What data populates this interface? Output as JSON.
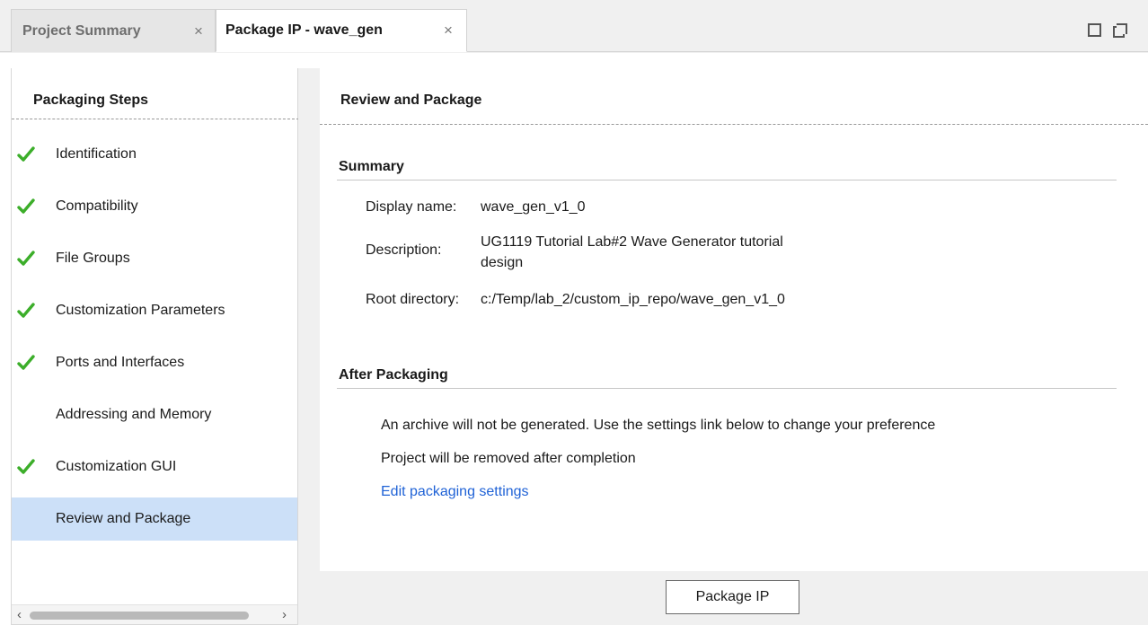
{
  "tabs": [
    {
      "label": "Project Summary",
      "close": "×"
    },
    {
      "label": "Package IP - wave_gen",
      "close": "×"
    }
  ],
  "colors": {
    "check": "#3cae2a",
    "selected_bg": "#cce0f8",
    "link": "#1f62d6"
  },
  "left": {
    "title": "Packaging Steps",
    "steps": [
      {
        "label": "Identification",
        "done": true,
        "icon": "check-icon"
      },
      {
        "label": "Compatibility",
        "done": true,
        "icon": "check-icon"
      },
      {
        "label": "File Groups",
        "done": true,
        "icon": "check-icon"
      },
      {
        "label": "Customization Parameters",
        "done": true,
        "icon": "check-icon"
      },
      {
        "label": "Ports and Interfaces",
        "done": true,
        "icon": "check-icon"
      },
      {
        "label": "Addressing and Memory",
        "done": false
      },
      {
        "label": "Customization GUI",
        "done": true,
        "icon": "check-icon"
      },
      {
        "label": "Review and Package",
        "done": false,
        "selected": true
      }
    ],
    "scroll_left": "‹",
    "scroll_right": "›"
  },
  "right": {
    "title": "Review and Package",
    "summary": {
      "title": "Summary",
      "display_name_label": "Display name:",
      "display_name": "wave_gen_v1_0",
      "description_label": "Description:",
      "description_line1": "UG1119 Tutorial Lab#2 Wave Generator tutorial",
      "description_line2": "design",
      "root_dir_label": "Root directory:",
      "root_dir": "c:/Temp/lab_2/custom_ip_repo/wave_gen_v1_0"
    },
    "after": {
      "title": "After Packaging",
      "line1": "An archive will not be generated. Use the settings link below to change your preference",
      "line2": "Project will be removed after completion",
      "link": "Edit packaging settings"
    },
    "package_button": "Package IP"
  }
}
